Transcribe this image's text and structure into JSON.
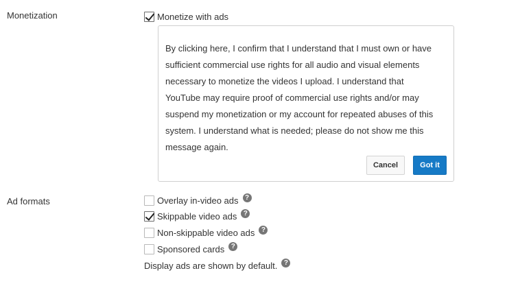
{
  "monetization": {
    "label": "Monetization",
    "monetize_checkbox": {
      "label": "Monetize with ads",
      "checked": true
    },
    "confirm_dialog": {
      "message": "By clicking here, I confirm that I understand that I must own or have sufficient commercial use rights for all audio and visual elements necessary to monetize the videos I upload. I understand that YouTube may require proof of commercial use rights and/or may suspend my monetization or my account for repeated abuses of this system. I understand what is needed; please do not show me this message again.",
      "cancel_label": "Cancel",
      "confirm_label": "Got it"
    }
  },
  "ad_formats": {
    "label": "Ad formats",
    "options": [
      {
        "label": "Overlay in-video ads",
        "checked": false
      },
      {
        "label": "Skippable video ads",
        "checked": true
      },
      {
        "label": "Non-skippable video ads",
        "checked": false
      },
      {
        "label": "Sponsored cards",
        "checked": false
      }
    ],
    "default_note": "Display ads are shown by default."
  },
  "icons": {
    "help": "?"
  },
  "colors": {
    "primary_button": "#167ac6",
    "help_icon": "#767676"
  }
}
